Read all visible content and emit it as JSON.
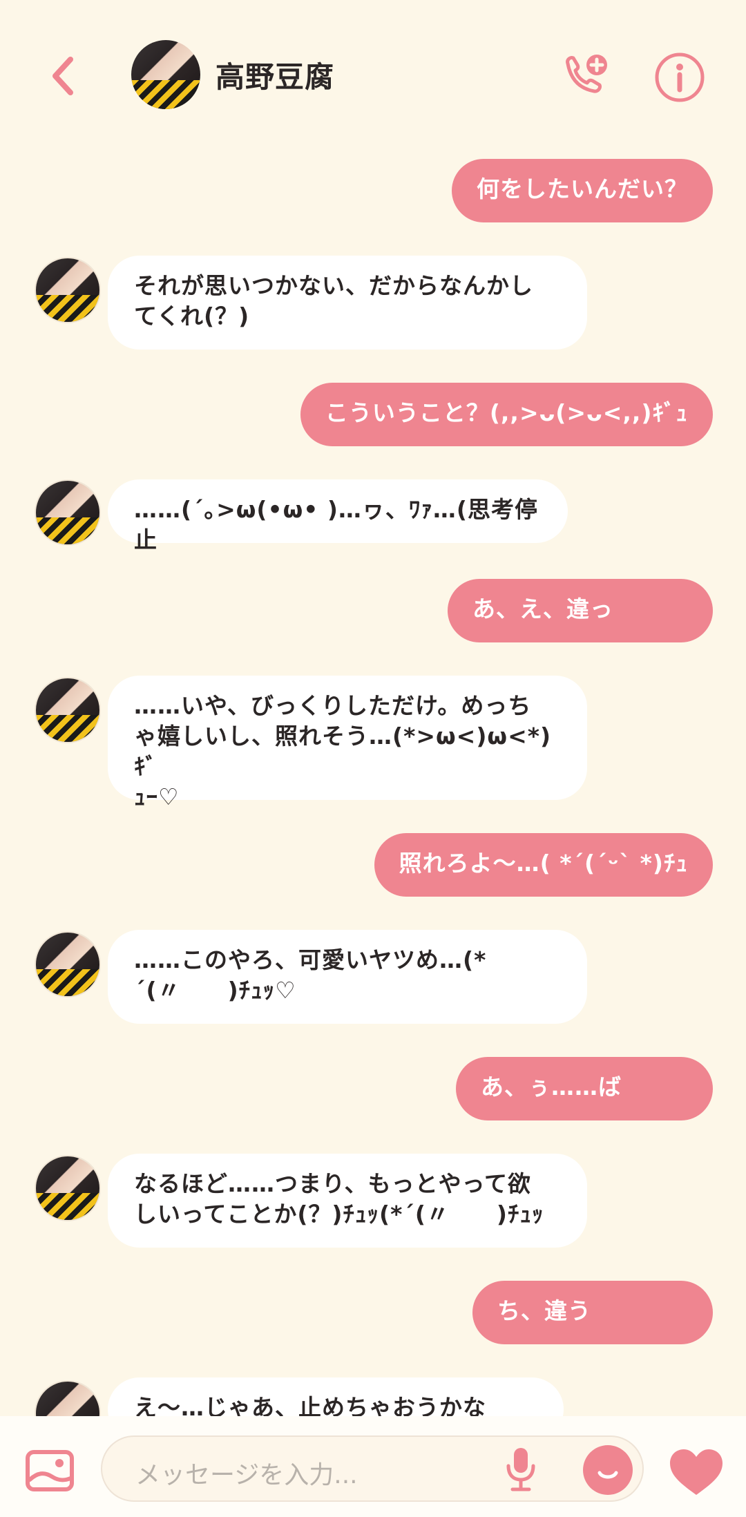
{
  "header": {
    "title": "高野豆腐",
    "back_icon": "chevron-left-icon",
    "call_icon": "phone-add-icon",
    "info_icon": "info-icon"
  },
  "messages": [
    {
      "dir": "out",
      "text": "何をしたいんだい？"
    },
    {
      "dir": "in",
      "text": "それが思いつかない、だからなんかし\nてくれ(？)"
    },
    {
      "dir": "out",
      "text": "こういうこと？(,,>ᴗ(>ᴗ<,,)ｷﾞｭ"
    },
    {
      "dir": "in",
      "text": "……(´｡>ω(•ω•  )…ヮ、ﾜｧ…(思考停止"
    },
    {
      "dir": "out",
      "text": "あ、え、違っ"
    },
    {
      "dir": "in",
      "text": "……いや、びっくりしただけ。めっち\nゃ嬉しいし、照れそう…(*>ω<)ω<*)ｷﾞ\nｭｰ♡"
    },
    {
      "dir": "out",
      "text": "照れろよ〜…( *´(´ᵕ` *)ﾁｭ"
    },
    {
      "dir": "in",
      "text": "……このやろ、可愛いヤツめ…(*\n´(〃　　)ﾁｭｯ♡"
    },
    {
      "dir": "out",
      "text": "あ、ぅ……ば"
    },
    {
      "dir": "in",
      "text": "なるほど……つまり、もっとやって欲\nしいってことか(？)ﾁｭｯ(*´(〃　　)ﾁｭｯ"
    },
    {
      "dir": "out",
      "text": "ち、違う"
    },
    {
      "dir": "in",
      "text": "え〜…じゃあ、止めちゃおうかな"
    }
  ],
  "input": {
    "placeholder": "メッセージを入力...",
    "image_icon": "image-icon",
    "mic_icon": "microphone-icon",
    "emoji_icon": "emoji-icon",
    "like_icon": "heart-icon"
  },
  "colors": {
    "accent": "#ef8590",
    "background": "#fdf7e8",
    "incoming_bubble": "#ffffff"
  }
}
